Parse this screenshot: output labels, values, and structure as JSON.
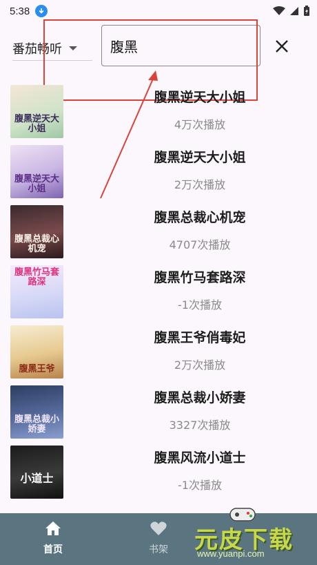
{
  "status_bar": {
    "time": "5:38"
  },
  "header": {
    "source_select": "番茄畅听",
    "search_value": "腹黑"
  },
  "results": [
    {
      "title": "腹黑逆天大小姐",
      "plays": "4万次播放",
      "cover_text": "腹黑逆天大小姐"
    },
    {
      "title": "腹黑逆天大小姐",
      "plays": "2万次播放",
      "cover_text": "腹黑逆天大小姐"
    },
    {
      "title": "腹黑总裁心机宠",
      "plays": "4707次播放",
      "cover_text": "腹黑总裁心机宠"
    },
    {
      "title": "腹黑竹马套路深",
      "plays": "-1次播放",
      "cover_text": "腹黑竹马套路深"
    },
    {
      "title": "腹黑王爷俏毒妃",
      "plays": "2万次播放",
      "cover_text": "腹黑王爷"
    },
    {
      "title": "腹黑总裁小娇妻",
      "plays": "3327次播放",
      "cover_text": "腹黑总裁小娇妻"
    },
    {
      "title": "腹黑风流小道士",
      "plays": "-1次播放",
      "cover_text": "小道士"
    }
  ],
  "bottom_nav": {
    "home": "首页",
    "bookshelf": "书架"
  },
  "watermark": {
    "logo": "元皮下载",
    "url": "www.yuanpi.com"
  },
  "colors": {
    "nav_bg": "#5b7580",
    "annotation": "#d9433a",
    "download_badge": "#2a8df2"
  }
}
